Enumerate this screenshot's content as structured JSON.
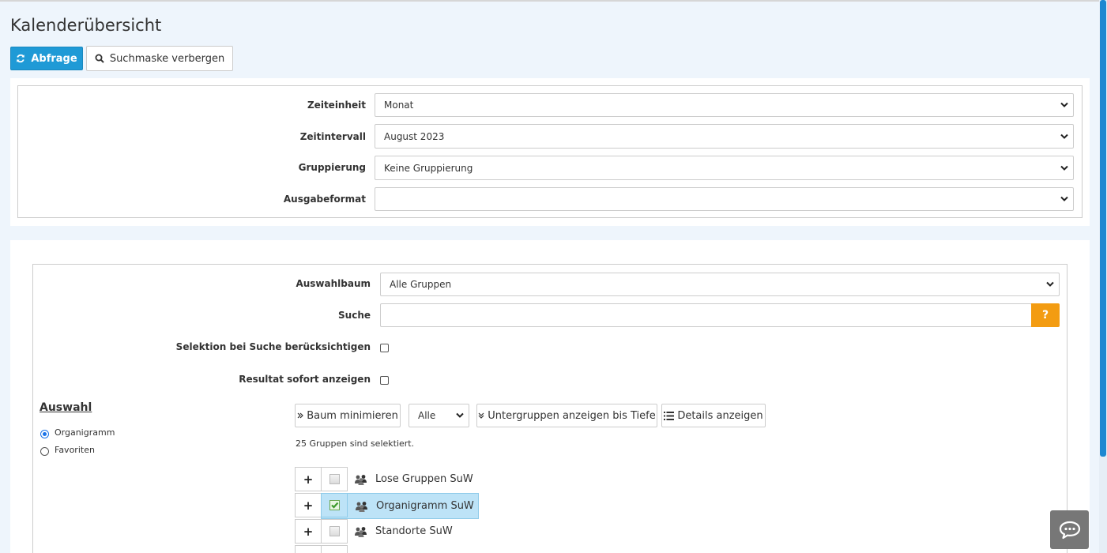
{
  "page": {
    "title": "Kalenderübersicht"
  },
  "toolbar": {
    "query_label": "Abfrage",
    "hide_search_label": "Suchmaske verbergen"
  },
  "filters": {
    "zeiteinheit": {
      "label": "Zeiteinheit",
      "value": "Monat"
    },
    "zeitintervall": {
      "label": "Zeitintervall",
      "value": "August 2023"
    },
    "gruppierung": {
      "label": "Gruppierung",
      "value": "Keine Gruppierung"
    },
    "ausgabeformat": {
      "label": "Ausgabeformat",
      "value": ""
    }
  },
  "selection": {
    "tree": {
      "label": "Auswahlbaum",
      "value": "Alle Gruppen"
    },
    "search": {
      "label": "Suche",
      "value": "",
      "help": "?"
    },
    "consider_selection": {
      "label": "Selektion bei Suche berücksichtigen",
      "checked": false
    },
    "show_result": {
      "label": "Resultat sofort anzeigen",
      "checked": false
    }
  },
  "auswahl": {
    "title": "Auswahl",
    "options": [
      {
        "label": "Organigramm",
        "selected": true
      },
      {
        "label": "Favoriten",
        "selected": false
      }
    ]
  },
  "tree_toolbar": {
    "minimize_label": "Baum minimieren",
    "depth_value": "Alle",
    "subgroups_label": "Untergruppen anzeigen bis Tiefe",
    "details_label": "Details anzeigen"
  },
  "status": "25 Gruppen sind selektiert.",
  "tree": {
    "expand_symbol": "+",
    "items": [
      {
        "label": "Lose Gruppen SuW",
        "checked": false
      },
      {
        "label": "Organigramm SuW",
        "checked": true
      },
      {
        "label": "Standorte SuW",
        "checked": false
      }
    ]
  },
  "colors": {
    "primary": "#1f9ad6",
    "help": "#f39c12",
    "selected_row": "#bde3f7",
    "scrollbar": "#1e88d1"
  },
  "icons": [
    "refresh-icon",
    "search-icon",
    "chevron-down-icon",
    "double-chevron-right-icon",
    "double-chevron-down-icon",
    "list-icon",
    "group-icon",
    "chat-icon"
  ]
}
